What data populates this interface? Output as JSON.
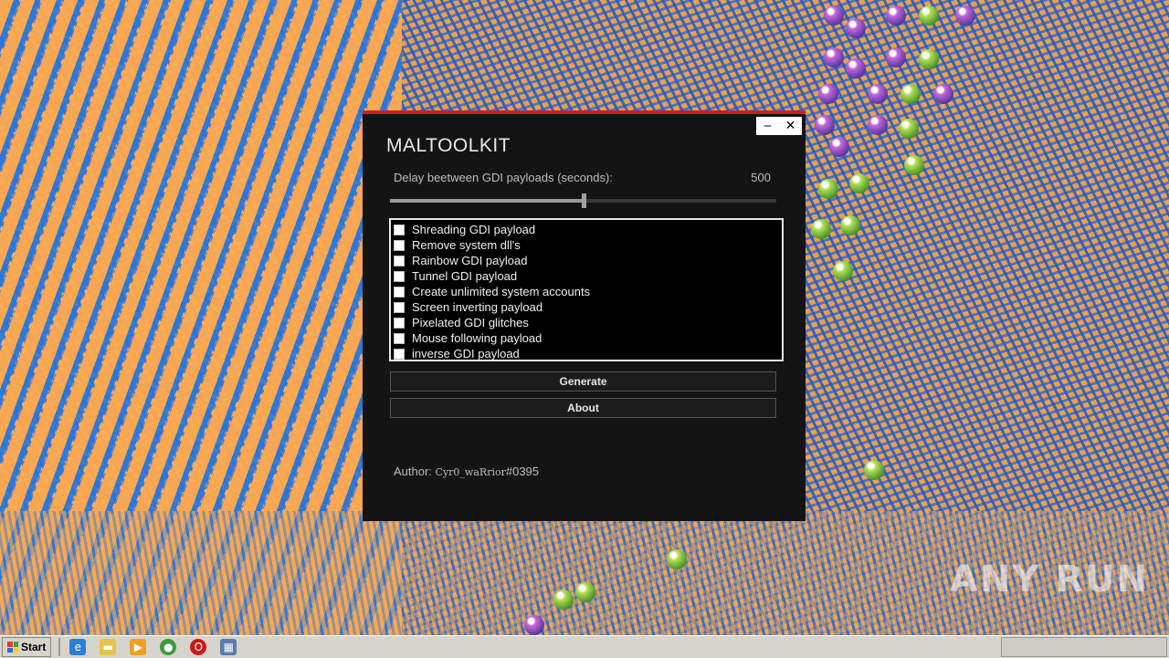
{
  "window": {
    "title": "MALTOOLKIT",
    "minimize_glyph": "‒",
    "close_glyph": "✕",
    "accent_color": "#d01c2a"
  },
  "delay": {
    "label": "Delay beetween GDI payloads (seconds):",
    "value": "500",
    "slider_fraction": 0.5
  },
  "payloads": [
    {
      "label": "Shreading GDI payload",
      "checked": false
    },
    {
      "label": "Remove system dll's",
      "checked": false
    },
    {
      "label": "Rainbow GDI payload",
      "checked": false
    },
    {
      "label": "Tunnel GDI payload",
      "checked": false
    },
    {
      "label": "Create unlimited system accounts",
      "checked": false
    },
    {
      "label": "Screen inverting payload",
      "checked": false
    },
    {
      "label": "Pixelated GDI glitches",
      "checked": false
    },
    {
      "label": "Mouse following payload",
      "checked": false
    },
    {
      "label": "inverse GDI payload",
      "checked": false
    }
  ],
  "buttons": {
    "generate": "Generate",
    "about": "About"
  },
  "author": {
    "prefix": "Author:",
    "name": "Cyr0_waRrior",
    "tag": "#0395"
  },
  "watermark": "ANY RUN",
  "taskbar": {
    "start_label": "Start",
    "icons": [
      "ie-icon",
      "explorer-icon",
      "media-player-icon",
      "chrome-icon",
      "opera-icon",
      "app-icon"
    ]
  }
}
